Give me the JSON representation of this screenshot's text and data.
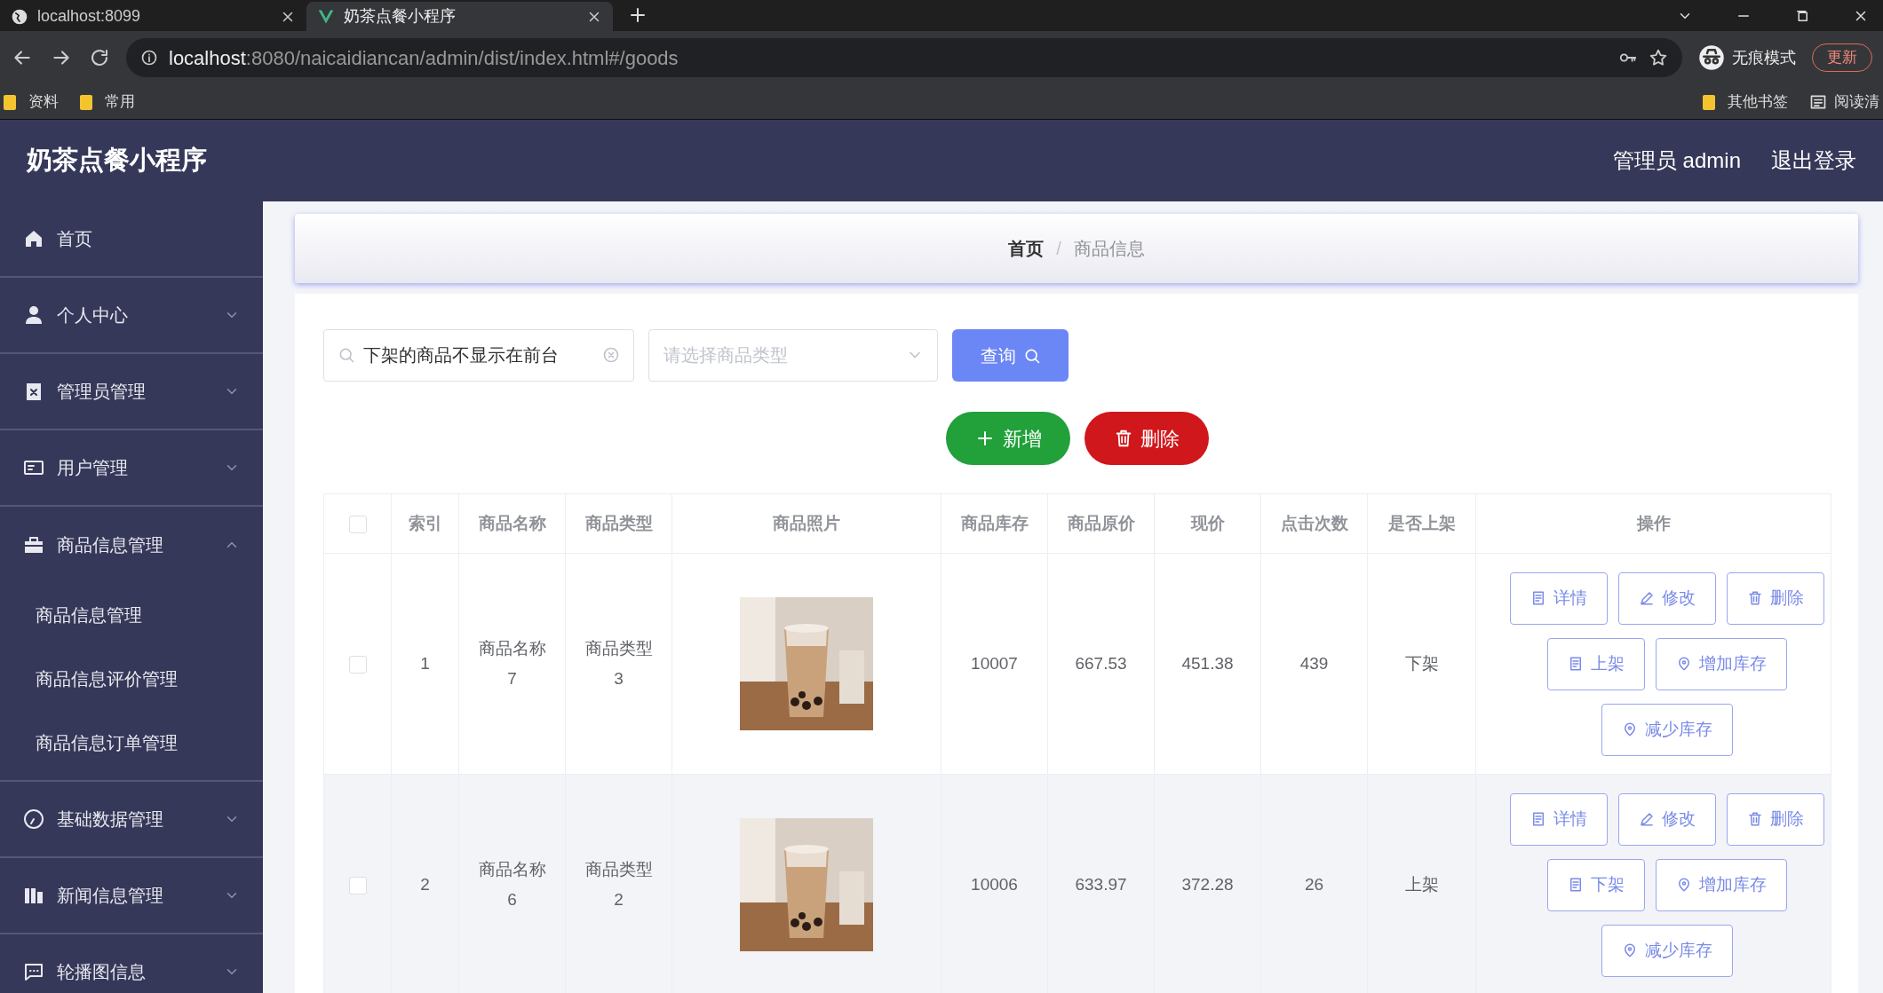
{
  "browser": {
    "tabs": [
      {
        "title": "localhost:8099",
        "selected": false
      },
      {
        "title": "奶茶点餐小程序",
        "selected": true
      }
    ],
    "address": {
      "host": "localhost",
      "rest": ":8080/naicaidiancan/admin/dist/index.html#/goods"
    },
    "profile": "无痕模式",
    "update_button": "更新",
    "bookmarks": [
      "资料",
      "常用"
    ],
    "other_bookmarks": "其他书签",
    "reading_list": "阅读清"
  },
  "app": {
    "title": "奶茶点餐小程序",
    "header_links": [
      "管理员 admin",
      "退出登录"
    ]
  },
  "sidebar": {
    "items": [
      {
        "kind": "link",
        "label": "首页"
      },
      {
        "kind": "group",
        "label": "个人中心",
        "expanded": false
      },
      {
        "kind": "group",
        "label": "管理员管理",
        "expanded": false
      },
      {
        "kind": "group",
        "label": "用户管理",
        "expanded": false
      },
      {
        "kind": "group",
        "label": "商品信息管理",
        "expanded": true,
        "children": [
          {
            "label": "商品信息管理"
          },
          {
            "label": "商品信息评价管理"
          },
          {
            "label": "商品信息订单管理"
          }
        ]
      },
      {
        "kind": "group",
        "label": "基础数据管理",
        "expanded": false
      },
      {
        "kind": "group",
        "label": "新闻信息管理",
        "expanded": false
      },
      {
        "kind": "group",
        "label": "轮播图信息",
        "expanded": false
      }
    ]
  },
  "breadcrumb": [
    "首页",
    "商品信息"
  ],
  "breadcrumb_separator": "/",
  "search": {
    "value": "下架的商品不显示在前台",
    "type_placeholder": "请选择商品类型",
    "query_button": "查询"
  },
  "actions": {
    "add": "新增",
    "delete": "删除"
  },
  "table": {
    "select_all": {
      "checked": false
    },
    "columns": [
      "索引",
      "商品名称",
      "商品类型",
      "商品照片",
      "商品库存",
      "商品原价",
      "现价",
      "点击次数",
      "是否上架",
      "操作"
    ],
    "rows": [
      {
        "checked": false,
        "index": "1",
        "name": "商品名称7",
        "type": "商品类型3",
        "stock": "10007",
        "price": "667.53",
        "current_price": "451.38",
        "clicks": "439",
        "on_shelf": "下架",
        "buttons": [
          {
            "kind": "detail",
            "label": "详情"
          },
          {
            "kind": "edit",
            "label": "修改"
          },
          {
            "kind": "delete",
            "label": "删除"
          },
          {
            "kind": "toggle",
            "label": "上架"
          },
          {
            "kind": "add-stock",
            "label": "增加库存"
          },
          {
            "kind": "reduce-stock",
            "label": "减少库存"
          }
        ]
      },
      {
        "checked": false,
        "index": "2",
        "name": "商品名称6",
        "type": "商品类型2",
        "stock": "10006",
        "price": "633.97",
        "current_price": "372.28",
        "clicks": "26",
        "on_shelf": "上架",
        "buttons": [
          {
            "kind": "detail",
            "label": "详情"
          },
          {
            "kind": "edit",
            "label": "修改"
          },
          {
            "kind": "delete",
            "label": "删除"
          },
          {
            "kind": "toggle",
            "label": "下架"
          },
          {
            "kind": "add-stock",
            "label": "增加库存"
          },
          {
            "kind": "reduce-stock",
            "label": "减少库存"
          }
        ]
      }
    ]
  }
}
